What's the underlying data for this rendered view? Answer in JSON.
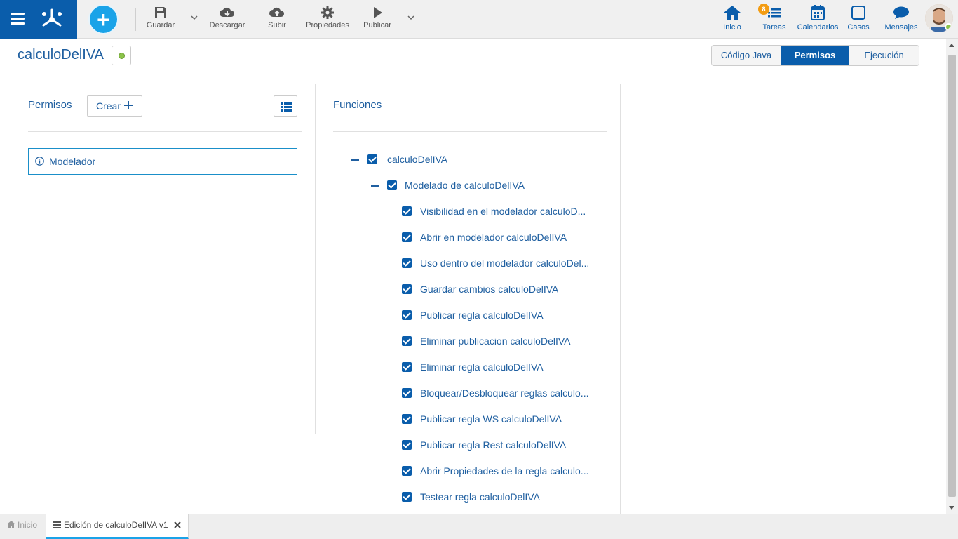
{
  "toolbar": {
    "add_label": "+",
    "items": [
      {
        "label": "Guardar"
      },
      {
        "label": "Descargar"
      },
      {
        "label": "Subir"
      },
      {
        "label": "Propiedades"
      },
      {
        "label": "Publicar"
      }
    ]
  },
  "nav": {
    "inicio": "Inicio",
    "tareas": "Tareas",
    "tareas_badge": "8",
    "calendarios": "Calendarios",
    "casos": "Casos",
    "mensajes": "Mensajes"
  },
  "header": {
    "title": "calculoDelIVA",
    "status_color": "#8bc34a",
    "tabs": [
      {
        "label": "Código Java",
        "active": false
      },
      {
        "label": "Permisos",
        "active": true
      },
      {
        "label": "Ejecución",
        "active": false
      }
    ]
  },
  "permisos": {
    "title": "Permisos",
    "crear_label": "Crear",
    "items": [
      {
        "label": "Modelador"
      }
    ]
  },
  "funciones": {
    "title": "Funciones",
    "root": {
      "label": "calculoDelIVA",
      "checked": true,
      "expanded": true
    },
    "group": {
      "label": "Modelado de calculoDelIVA",
      "checked": true,
      "expanded": true
    },
    "items": [
      {
        "label": "Visibilidad en el modelador calculoD...",
        "checked": true
      },
      {
        "label": "Abrir en modelador calculoDelIVA",
        "checked": true
      },
      {
        "label": "Uso dentro del modelador calculoDel...",
        "checked": true
      },
      {
        "label": "Guardar cambios calculoDelIVA",
        "checked": true
      },
      {
        "label": "Publicar regla calculoDelIVA",
        "checked": true
      },
      {
        "label": "Eliminar publicacion calculoDelIVA",
        "checked": true
      },
      {
        "label": "Eliminar regla calculoDelIVA",
        "checked": true
      },
      {
        "label": "Bloquear/Desbloquear reglas calculo...",
        "checked": true
      },
      {
        "label": "Publicar regla WS calculoDelIVA",
        "checked": true
      },
      {
        "label": "Publicar regla Rest calculoDelIVA",
        "checked": true
      },
      {
        "label": "Abrir Propiedades de la regla calculo...",
        "checked": true
      },
      {
        "label": "Testear regla calculoDelIVA",
        "checked": true
      }
    ]
  },
  "bottom_tabs": [
    {
      "label": "Inicio",
      "active": false
    },
    {
      "label": "Edición de calculoDelIVA v1",
      "active": true
    }
  ],
  "colors": {
    "brand": "#0a5dab",
    "accent": "#1aa3e8"
  }
}
